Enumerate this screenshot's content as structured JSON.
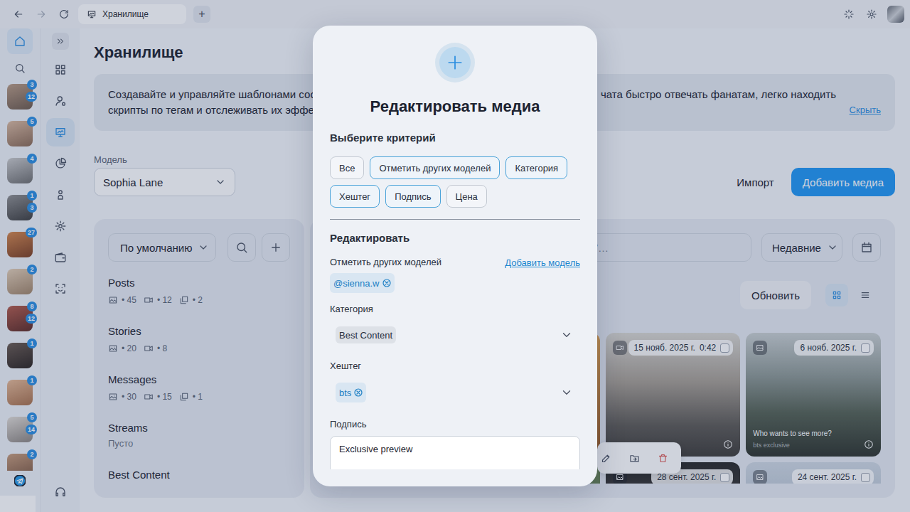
{
  "browser": {
    "tab_title": "Хранилище",
    "new_tab": "+",
    "forward_enabled": false
  },
  "accounts": [
    {
      "badges": [
        "3",
        "12"
      ]
    },
    {
      "badges": [
        "5"
      ]
    },
    {
      "badges": [
        "4"
      ]
    },
    {
      "badges": [
        "1",
        "3"
      ]
    },
    {
      "badges": [
        "27"
      ]
    },
    {
      "badges": [
        "2"
      ]
    },
    {
      "badges": [
        "8",
        "12"
      ]
    },
    {
      "badges": [
        "1"
      ]
    },
    {
      "badges": [
        "1"
      ]
    },
    {
      "badges": [
        "5",
        "14"
      ]
    },
    {
      "badges": [
        "2"
      ]
    }
  ],
  "nav": [
    {
      "selected": false
    },
    {
      "selected": false
    },
    {
      "selected": false
    },
    {
      "selected": true
    },
    {
      "selected": false
    },
    {
      "selected": false
    },
    {
      "selected": false
    },
    {
      "selected": false
    },
    {
      "selected": false
    }
  ],
  "page": {
    "title": "Хранилище",
    "banner": {
      "left_lines": [
        "Создавайте и управляйте шаблонами сооб",
        "скрипты по тегам и отслеживать их эффект"
      ],
      "right_line": "чата быстро отвечать фанатам, легко находить",
      "hide": "Скрыть"
    },
    "model": {
      "label": "Модель",
      "value": "Sophia Lane"
    },
    "import": "Импорт",
    "add": "Добавить медиа"
  },
  "folders": {
    "sort": "По умолчанию",
    "items": [
      {
        "name": "Posts",
        "stats": [
          {
            "kind": "photo",
            "count": "• 45"
          },
          {
            "kind": "video",
            "count": "• 12"
          },
          {
            "kind": "album",
            "count": "• 2"
          }
        ]
      },
      {
        "name": "Stories",
        "stats": [
          {
            "kind": "photo",
            "count": "• 20"
          },
          {
            "kind": "video",
            "count": "• 8"
          }
        ]
      },
      {
        "name": "Messages",
        "stats": [
          {
            "kind": "photo",
            "count": "• 30"
          },
          {
            "kind": "video",
            "count": "• 15"
          },
          {
            "kind": "album",
            "count": "• 1"
          }
        ]
      },
      {
        "name": "Streams",
        "stats": [],
        "empty": "Пусто"
      },
      {
        "name": "Best Content",
        "stats": []
      }
    ]
  },
  "media": {
    "search_placeholder": "PPV…",
    "sort": "Недавние",
    "refresh": "Обновить",
    "views": [
      {
        "selected": true
      },
      {
        "selected": false
      }
    ],
    "cards": [
      {
        "kind": "image",
        "checked": false
      },
      {
        "kind": "image",
        "checked": false
      },
      {
        "kind": "video",
        "date": "15 нояб. 2025 г.",
        "time": "0:42",
        "checked": false
      },
      {
        "kind": "image",
        "date": "6 нояб. 2025 г.",
        "checked": false,
        "caption": "Who wants to see more?",
        "tag": "bts exclusive"
      },
      {
        "kind": "image",
        "checked": false
      },
      {
        "kind": "image",
        "checked": false
      },
      {
        "kind": "image",
        "date": "28 сент. 2025 г.",
        "checked": false
      },
      {
        "kind": "image",
        "date": "24 сент. 2025 г.",
        "checked": false
      }
    ]
  },
  "modal": {
    "title": "Редактировать медиа",
    "criteria_label": "Выберите критерий",
    "criteria": [
      {
        "label": "Все",
        "selected": false
      },
      {
        "label": "Отметить других моделей",
        "selected": true
      },
      {
        "label": "Категория",
        "selected": true
      },
      {
        "label": "Хештег",
        "selected": true
      },
      {
        "label": "Подпись",
        "selected": true
      },
      {
        "label": "Цена",
        "selected": false
      }
    ],
    "edit_label": "Редактировать",
    "tag_models": {
      "label": "Отметить других моделей",
      "link": "Добавить модель",
      "tags": [
        "@sienna.w"
      ]
    },
    "category": {
      "label": "Категория",
      "value": "Best Content"
    },
    "hashtag": {
      "label": "Хештег",
      "tags": [
        "bts"
      ]
    },
    "caption": {
      "label": "Подпись",
      "value": "Exclusive preview"
    }
  }
}
